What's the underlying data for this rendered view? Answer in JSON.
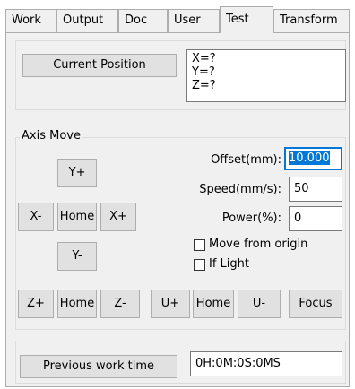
{
  "tabs": [
    {
      "label": "Work"
    },
    {
      "label": "Output"
    },
    {
      "label": "Doc"
    },
    {
      "label": "User"
    },
    {
      "label": "Test"
    },
    {
      "label": "Transform"
    }
  ],
  "active_tab": "Test",
  "position": {
    "button": "Current Position",
    "x": "X=?",
    "y": "Y=?",
    "z": "Z=?"
  },
  "axis_move": {
    "title": "Axis Move",
    "y_plus": "Y+",
    "y_minus": "Y-",
    "x_minus": "X-",
    "x_plus": "X+",
    "home": "Home",
    "z_plus": "Z+",
    "z_minus": "Z-",
    "u_plus": "U+",
    "u_minus": "U-",
    "focus": "Focus",
    "offset_label": "Offset(mm):",
    "offset_value": "10.000",
    "speed_label": "Speed(mm/s):",
    "speed_value": "50",
    "power_label": "Power(%):",
    "power_value": "0",
    "move_from_origin": "Move from origin",
    "if_light": "If Light"
  },
  "work_time": {
    "button": "Previous work time",
    "value": "0H:0M:0S:0MS"
  }
}
